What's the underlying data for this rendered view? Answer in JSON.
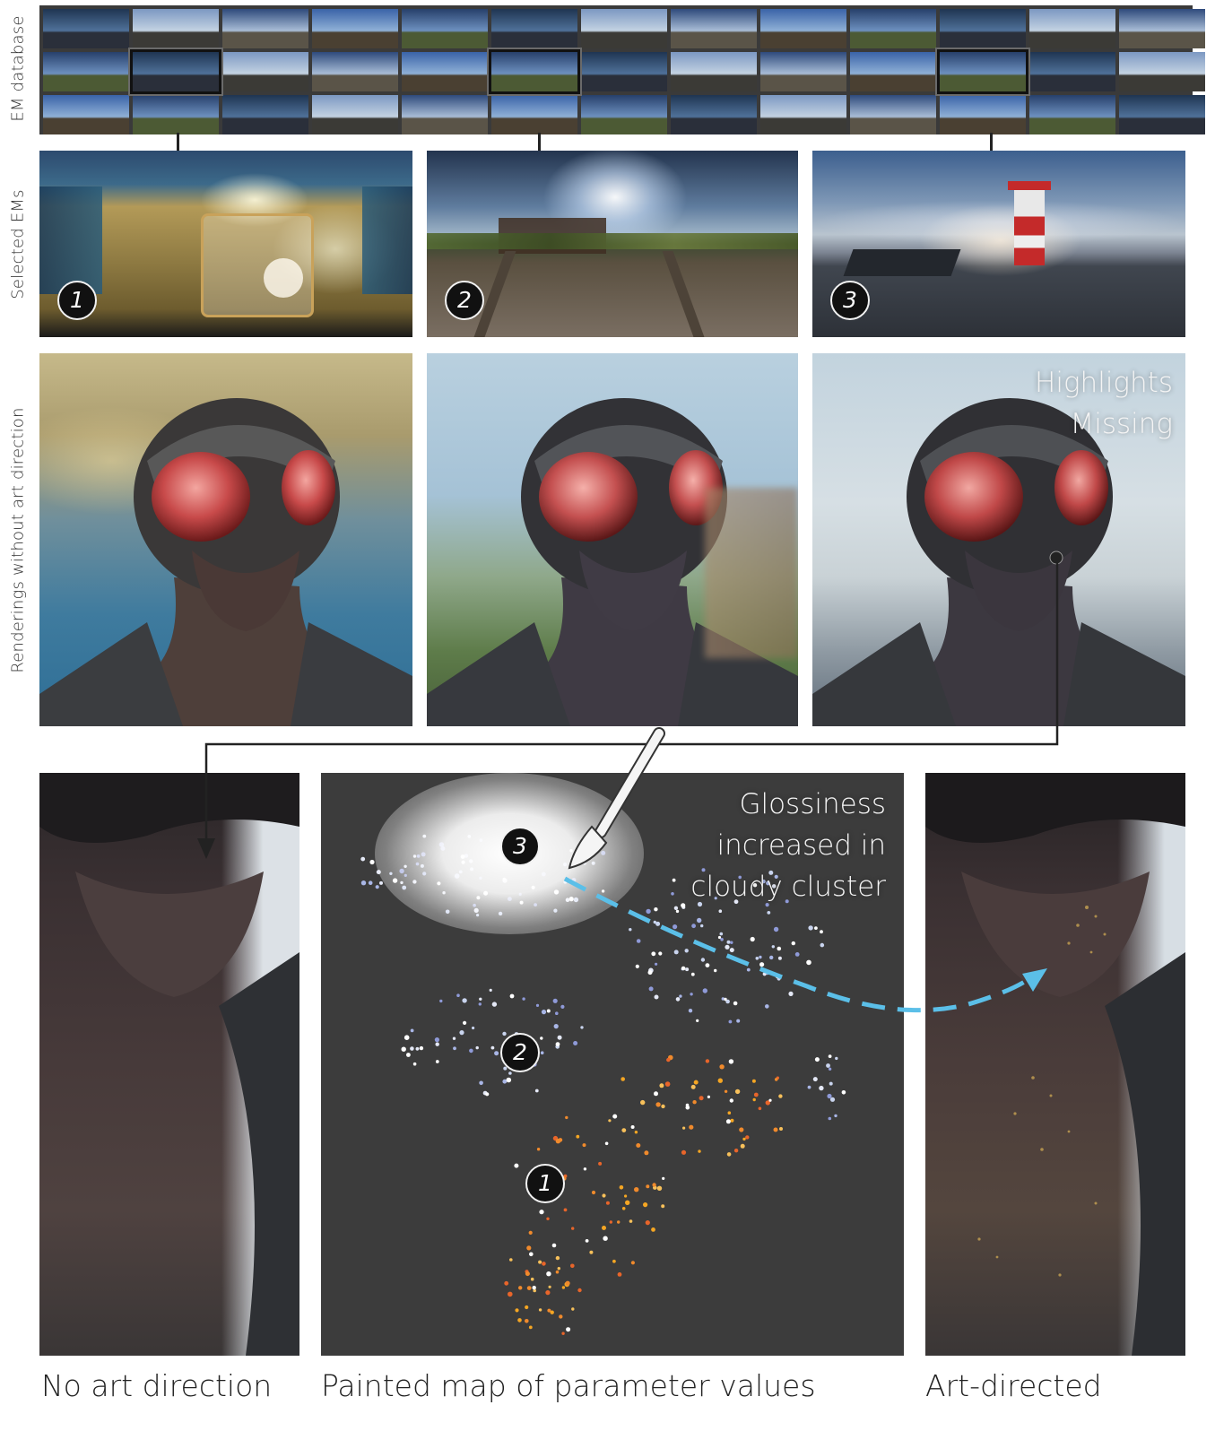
{
  "row_labels": {
    "em_database": "EM database",
    "selected_ems": "Selected EMs",
    "renderings": "Renderings without art direction"
  },
  "badges": {
    "one": "1",
    "two": "2",
    "three": "3"
  },
  "annotations": {
    "highlights_line1": "Highlights",
    "highlights_line2": "Missing",
    "glossiness_line1": "Glossiness",
    "glossiness_line2": "increased in",
    "glossiness_line3": "cloudy cluster"
  },
  "captions": {
    "no_art": "No art direction",
    "painted_map": "Painted map of parameter values",
    "art_directed": "Art-directed"
  },
  "colors": {
    "accent_arrow": "#5bbfe8",
    "map_background": "#3c3c3c",
    "cluster_1": "#f5a623",
    "cluster_2": "#c9d4ee",
    "cluster_3": "#a9b6e6"
  },
  "icons": [
    "paintbrush-icon",
    "arrow-down-icon",
    "dashed-arrow-icon"
  ]
}
